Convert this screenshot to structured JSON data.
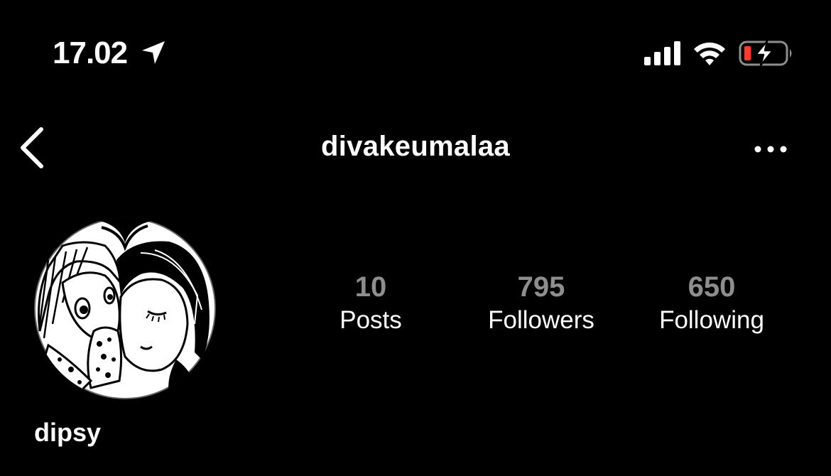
{
  "status_bar": {
    "time": "17.02",
    "icons": [
      "location-arrow-icon",
      "cellular-signal-icon",
      "wifi-icon",
      "battery-charging-icon"
    ],
    "battery_level_color": "#ff3b30"
  },
  "header": {
    "username": "divakeumalaa",
    "back_icon": "chevron-left-icon",
    "more_icon": "more-horizontal-icon"
  },
  "profile": {
    "display_name": "dipsy",
    "avatar_icon": "avatar-manga-illustration",
    "stats": {
      "posts": {
        "value": "10",
        "label": "Posts"
      },
      "followers": {
        "value": "795",
        "label": "Followers"
      },
      "following": {
        "value": "650",
        "label": "Following"
      }
    }
  },
  "colors": {
    "background": "#000000",
    "text_primary": "#ffffff",
    "stat_number": "#8e8e8e"
  }
}
